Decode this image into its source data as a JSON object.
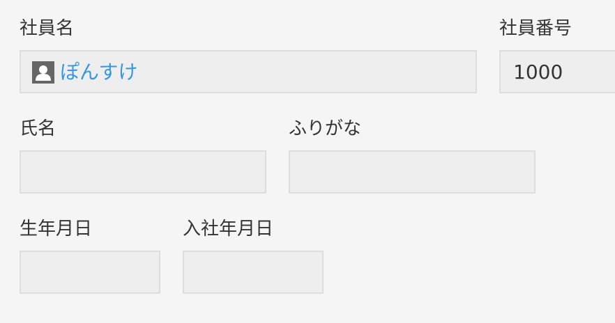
{
  "employee_name": {
    "label": "社員名",
    "user_icon": "user-icon",
    "value": "ぽんすけ"
  },
  "employee_number": {
    "label": "社員番号",
    "value": "1000"
  },
  "full_name": {
    "label": "氏名",
    "value": ""
  },
  "furigana": {
    "label": "ふりがな",
    "value": ""
  },
  "birth_date": {
    "label": "生年月日",
    "value": ""
  },
  "hire_date": {
    "label": "入社年月日",
    "value": ""
  },
  "colors": {
    "background": "#f5f5f5",
    "field_background": "#eeeeee",
    "field_border": "#dddddd",
    "link": "#3498db",
    "icon": "#666666",
    "text": "#333333"
  }
}
